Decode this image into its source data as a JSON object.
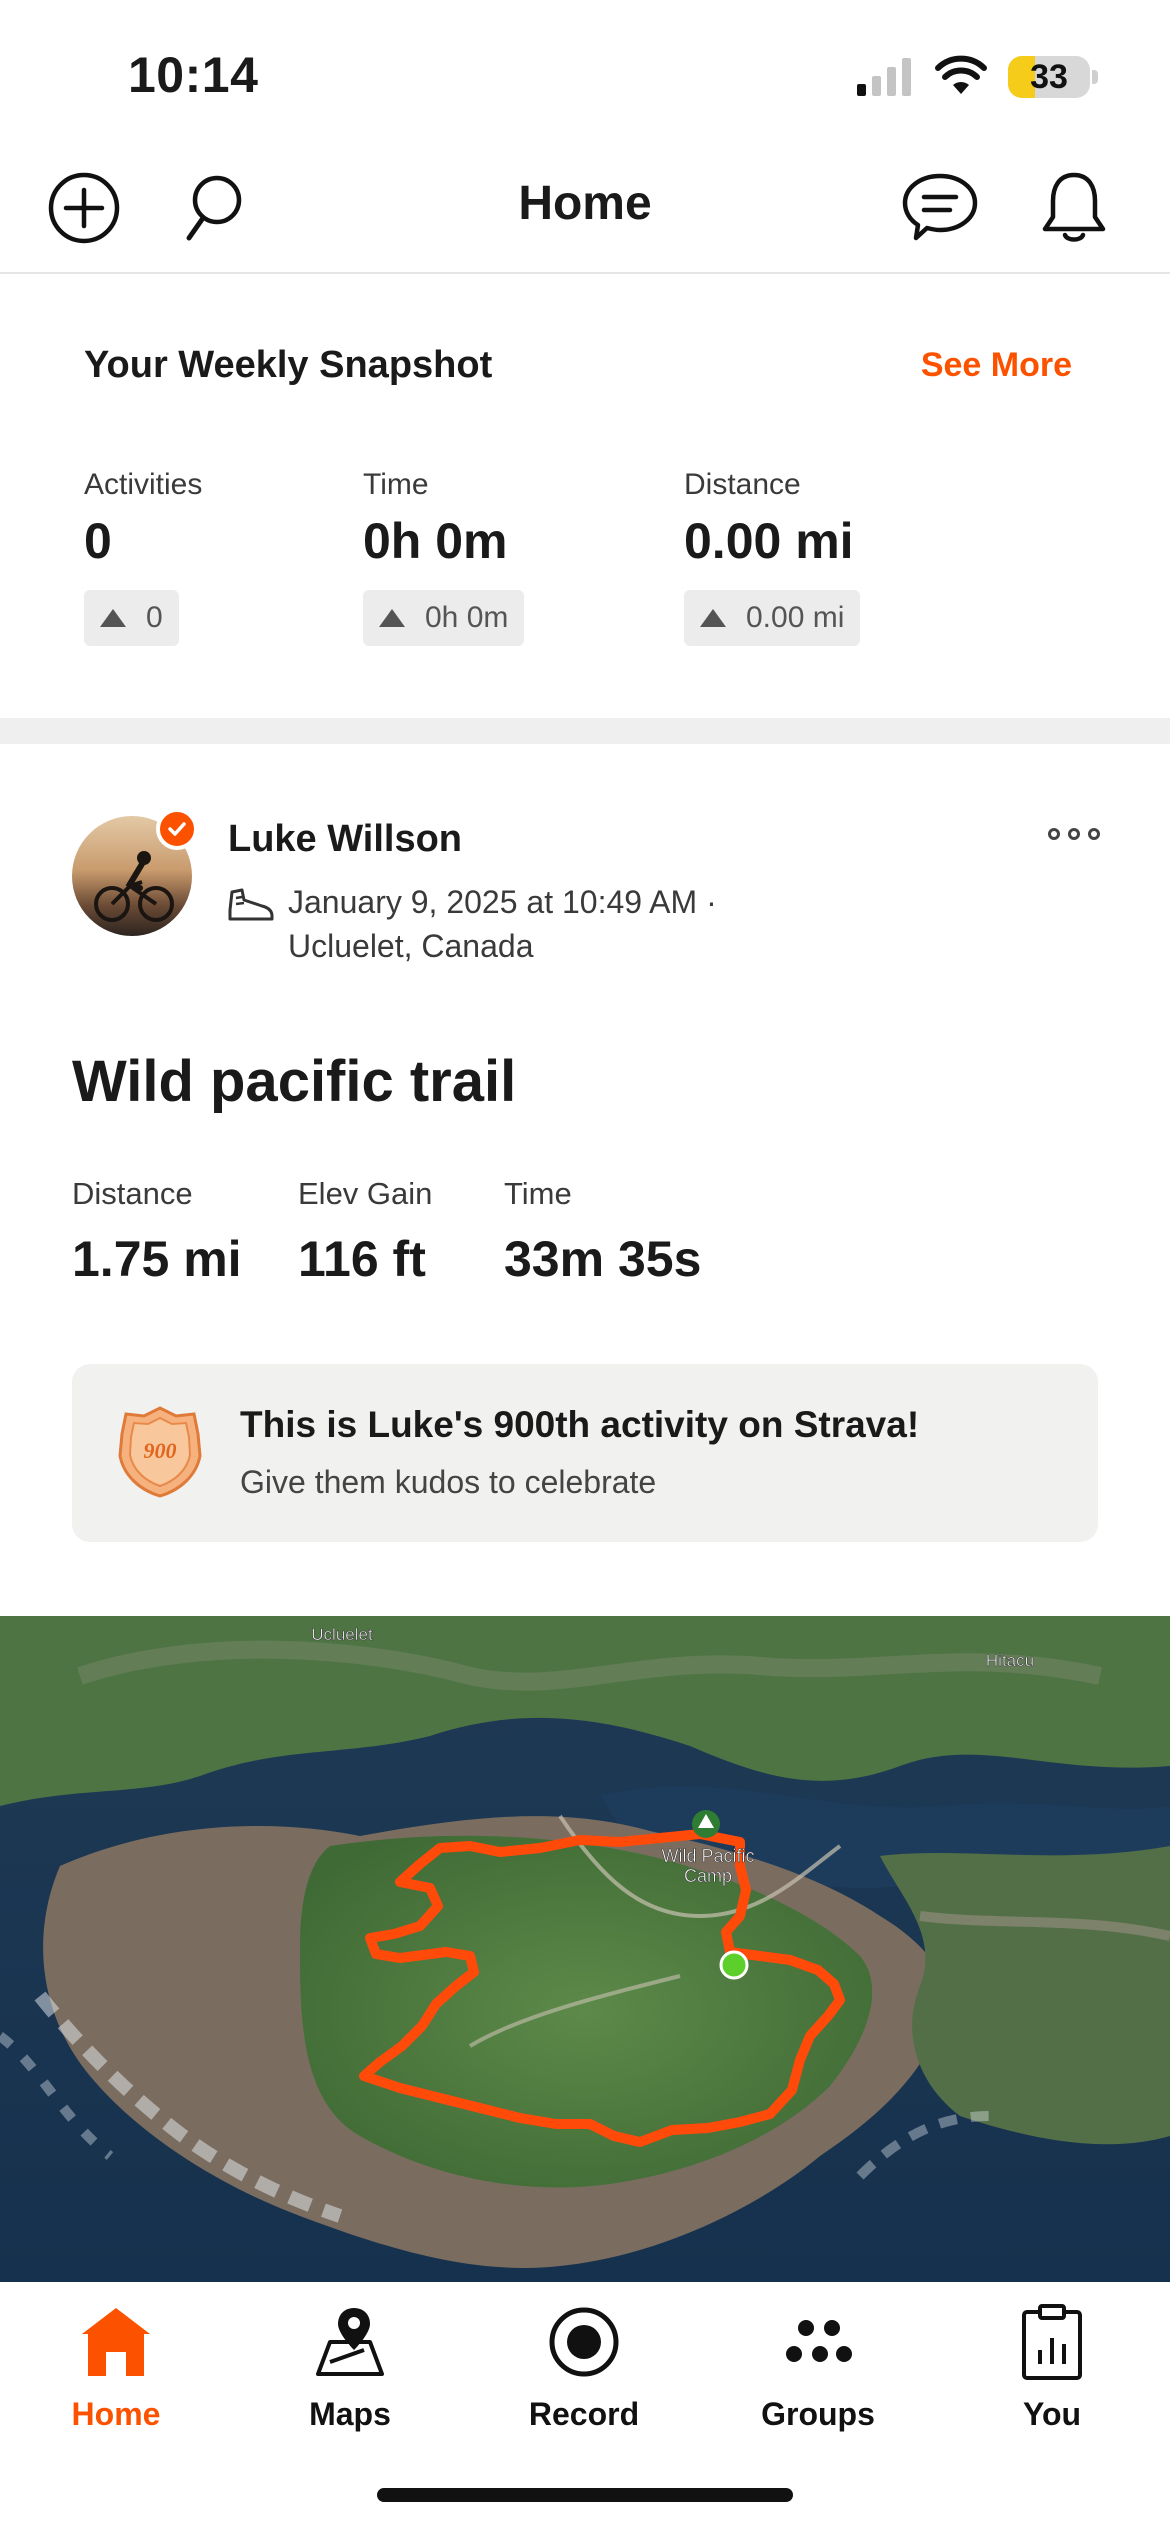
{
  "status_bar": {
    "time": "10:14",
    "battery": "33"
  },
  "header": {
    "title": "Home"
  },
  "snapshot": {
    "title": "Your Weekly Snapshot",
    "see_more": "See More",
    "stats": [
      {
        "label": "Activities",
        "value": "0",
        "delta": "0"
      },
      {
        "label": "Time",
        "value": "0h 0m",
        "delta": "0h 0m"
      },
      {
        "label": "Distance",
        "value": "0.00 mi",
        "delta": "0.00 mi"
      }
    ]
  },
  "activity": {
    "athlete": "Luke Willson",
    "meta_line1": "January 9, 2025 at 10:49 AM ·",
    "meta_line2": "Ucluelet, Canada",
    "title": "Wild pacific trail",
    "stats": [
      {
        "label": "Distance",
        "value": "1.75 mi"
      },
      {
        "label": "Elev Gain",
        "value": "116 ft"
      },
      {
        "label": "Time",
        "value": "33m 35s"
      }
    ],
    "milestone": {
      "badge": "900",
      "title": "This is Luke's 900th activity on Strava!",
      "subtitle": "Give them kudos to celebrate"
    },
    "map_labels": {
      "town": "Ucluelet",
      "area": "Hitacu",
      "camp_line1": "Wild Pacific",
      "camp_line2": "Camp"
    }
  },
  "tabs": [
    {
      "label": "Home",
      "icon": "home-icon",
      "active": true
    },
    {
      "label": "Maps",
      "icon": "maps-icon",
      "active": false
    },
    {
      "label": "Record",
      "icon": "record-icon",
      "active": false
    },
    {
      "label": "Groups",
      "icon": "groups-icon",
      "active": false
    },
    {
      "label": "You",
      "icon": "you-icon",
      "active": false
    }
  ],
  "colors": {
    "accent": "#fc5200",
    "route": "#ff4a0a",
    "start_marker": "#5ccf2a"
  }
}
